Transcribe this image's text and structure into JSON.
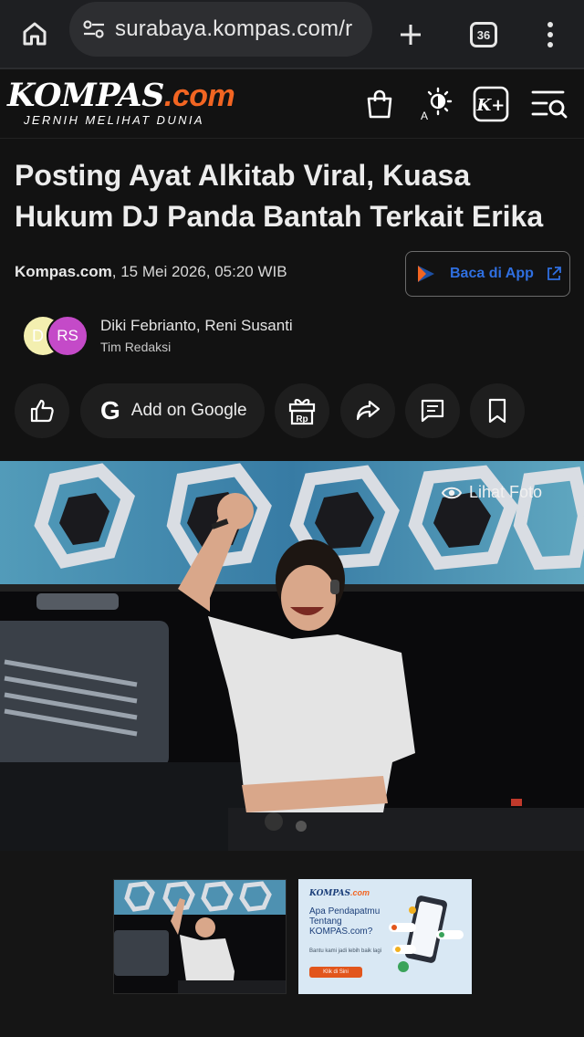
{
  "browser": {
    "url": "surabaya.kompas.com/r",
    "tab_count": "36"
  },
  "site": {
    "logo_main": "KOMPAS",
    "logo_com": ".com",
    "tagline": "JERNIH MELIHAT DUNIA",
    "kplus_label": "K+"
  },
  "article": {
    "headline": "Posting Ayat Alkitab Viral, Kuasa Hukum DJ Panda Bantah Terkait Erika",
    "source": "Kompas.com",
    "datetime": ", 15 Mei 2026, 05:20 WIB",
    "read_in_app": "Baca di App",
    "avatar_1": "D",
    "avatar_2": "RS",
    "authors": "Diki Febrianto,  Reni Susanti",
    "team": "Tim Redaksi",
    "add_on_google": "Add on Google",
    "google_g": "G",
    "gift_label": "Rp"
  },
  "photo": {
    "see_photo": "Lihat Foto"
  },
  "ad": {
    "logo": "KOMPAS",
    "logo_com": ".com",
    "question": "Apa Pendapatmu Tentang KOMPAS.com?",
    "help_text": "Bantu kami jadi lebih baik lagi",
    "cta": "Klik di Sini"
  }
}
